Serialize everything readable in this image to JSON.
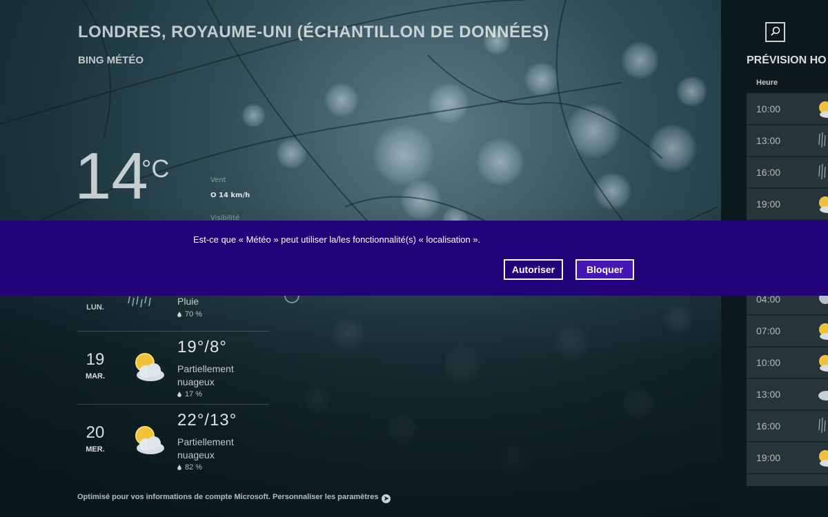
{
  "header": {
    "location_title": "LONDRES, ROYAUME-UNI (ÉCHANTILLON DE DONNÉES)",
    "provider": "BING MÉTÉO"
  },
  "current": {
    "temperature": "14",
    "unit": "°C",
    "wind_label": "Vent",
    "wind_value": "O 14 km/h",
    "visibility_label": "Visibilité"
  },
  "daily": {
    "partial": {
      "day_name": "LUN.",
      "condition": "Pluie",
      "precip": "70 %",
      "icon": "rain-icon"
    },
    "days": [
      {
        "number": "19",
        "day_name": "MAR.",
        "range": "19°/8°",
        "condition": "Partiellement nuageux",
        "precip": "17 %",
        "icon": "partly-cloudy-icon"
      },
      {
        "number": "20",
        "day_name": "MER.",
        "range": "22°/13°",
        "condition": "Partiellement nuageux",
        "precip": "82 %",
        "icon": "partly-cloudy-icon"
      }
    ]
  },
  "footer": {
    "text": "Optimisé pour vos informations de compte Microsoft. Personnaliser les paramètres"
  },
  "hourly_panel": {
    "title": "PRÉVISION HO",
    "column_header": "Heure",
    "rows": [
      {
        "time": "10:00",
        "icon": "partly-cloudy-icon"
      },
      {
        "time": "13:00",
        "icon": "rain-icon"
      },
      {
        "time": "16:00",
        "icon": "rain-icon"
      },
      {
        "time": "19:00",
        "icon": "partly-cloudy-icon"
      },
      {
        "time": "04:00",
        "icon": "partly-cloudy-icon"
      },
      {
        "time": "07:00",
        "icon": "partly-cloudy-icon"
      },
      {
        "time": "10:00",
        "icon": "partly-cloudy-icon"
      },
      {
        "time": "13:00",
        "icon": "cloudy-icon"
      },
      {
        "time": "16:00",
        "icon": "rain-icon"
      },
      {
        "time": "19:00",
        "icon": "partly-cloudy-icon"
      }
    ]
  },
  "permission_dialog": {
    "message": "Est-ce que « Météo » peut utiliser la/les fonctionnalité(s) « localisation ».",
    "allow_label": "Autoriser",
    "block_label": "Bloquer"
  },
  "colors": {
    "dialog_bg": "#22037a",
    "block_button_bg": "#4617b4",
    "panel_bg": "#0c1a1e"
  }
}
